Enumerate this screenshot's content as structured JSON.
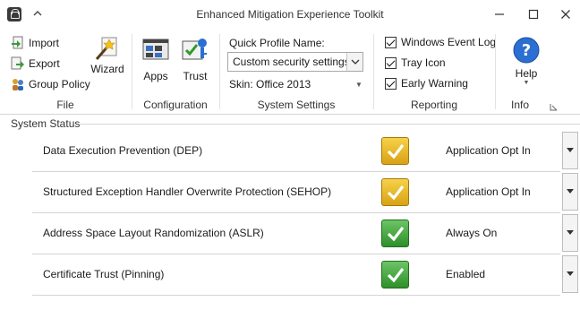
{
  "window": {
    "title": "Enhanced Mitigation Experience Toolkit",
    "icons": {
      "app": "lock-icon",
      "qat": "chevron-up-icon",
      "minimize": "minimize-icon",
      "maximize": "maximize-icon",
      "close": "close-icon"
    }
  },
  "ribbon": {
    "file_group": {
      "label": "File",
      "import_label": "Import",
      "export_label": "Export",
      "group_policy_label": "Group Policy",
      "wizard_label": "Wizard"
    },
    "configuration_group": {
      "label": "Configuration",
      "apps_label": "Apps",
      "trust_label": "Trust"
    },
    "system_settings_group": {
      "label": "System Settings",
      "profile_label": "Quick Profile Name:",
      "profile_value": "Custom security settings",
      "skin_label": "Skin: Office 2013"
    },
    "reporting_group": {
      "label": "Reporting",
      "event_log_label": "Windows Event Log",
      "event_log_checked": true,
      "tray_icon_label": "Tray Icon",
      "tray_icon_checked": true,
      "early_warning_label": "Early Warning",
      "early_warning_checked": true
    },
    "info_group": {
      "label": "Info",
      "help_label": "Help"
    }
  },
  "system_status": {
    "title": "System Status",
    "rows": [
      {
        "name": "Data Execution Prevention (DEP)",
        "status_color": "yellow",
        "setting": "Application Opt In"
      },
      {
        "name": "Structured Exception Handler Overwrite Protection (SEHOP)",
        "status_color": "yellow",
        "setting": "Application Opt In"
      },
      {
        "name": "Address Space Layout Randomization (ASLR)",
        "status_color": "green",
        "setting": "Always On"
      },
      {
        "name": "Certificate Trust (Pinning)",
        "status_color": "green",
        "setting": "Enabled"
      }
    ]
  },
  "colors": {
    "yellow": "#e2b321",
    "green": "#3f9f39",
    "help_blue": "#2a6fd1"
  }
}
